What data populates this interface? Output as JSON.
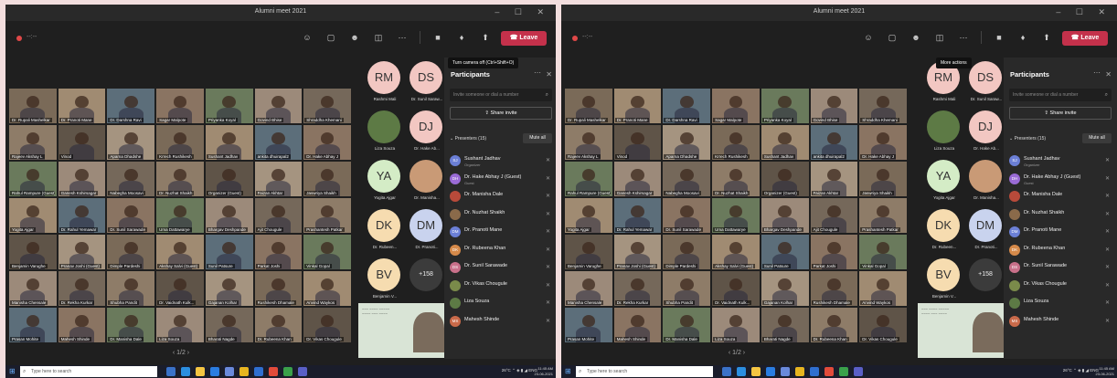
{
  "window": {
    "title": "Alumni meet 2021",
    "controls": "– ☐ ✕"
  },
  "toolbar": {
    "timer": "--:--",
    "icons": [
      "people-icon",
      "chat-icon",
      "reactions-icon",
      "rooms-icon",
      "more-icon",
      "camera-icon",
      "mic-icon",
      "share-icon"
    ],
    "leave_label": "Leave"
  },
  "tooltips": {
    "camera": "Turn camera off (Ctrl+Shift+O)",
    "more": "More actions"
  },
  "gallery": {
    "tiles": [
      "Dr. Rupali Mashelkar",
      "Dr. Pranoti Mane",
      "Dr. Darshna Ravi",
      "Sagar Malpote",
      "Priyanka Koyal",
      "Govind Bhise",
      "Shraddha Khemani",
      "Rajeev Akshay L",
      "Vinod",
      "Aparna Dhadshe",
      "Krrech Rushikesh",
      "Sushant Jadhav",
      "ankita dhuirapal2",
      "Dr. Hake Abhay J",
      "Rahul Rampure (Guest)",
      "Ganesh Kshirsagar",
      "Nabegha Moosavi",
      "Dr. Nuzhat Shaikh",
      "Organizer (Guest)",
      "Faizan Akhtar",
      "Jaswriya Shaikh",
      "Yogita Ajgar",
      "Dr. Rahul Yemawar",
      "Dr. Sunil Sarawade",
      "Uma Dattawarye",
      "Bhargav Deshpande",
      "Ajit Chougule",
      "Prashantesh Patkar",
      "Benjamin Varughe",
      "Pranav Joshi (Guest)",
      "Dimple Pardeshi",
      "Akshay Salvi (Guest)",
      "Sunil Patsure",
      "Parkat Joshi",
      "Vinkal Gopal",
      "Manisha Chensale",
      "Dr. Rekha Kurkar",
      "Shubha Pandit",
      "Dr. Vaidnath Kulk...",
      "Gajanan Kolhar",
      "Rushikesh Dhamale",
      "Anvind Waykos",
      "Prasan Mohite",
      "Mahesh Shinde",
      "Dr. Manisha Dale",
      "Liza Souza",
      "Bharati Nagde",
      "Dr. Rubeena Khan",
      "Dr. Vikas Chougule"
    ],
    "pager": "‹ 1/2 ›"
  },
  "avatars": [
    {
      "initials": "RM",
      "name": "Rashmi Mali",
      "color": "#f2c7c2"
    },
    {
      "initials": "DS",
      "name": "Dr. Sunil Saraw...",
      "color": "#f2c7c2"
    },
    {
      "initials": "",
      "name": "Liza Souza",
      "color": "#5d7a45"
    },
    {
      "initials": "DJ",
      "name": "Dr. Hake Ab...",
      "color": "#f2c7c2"
    },
    {
      "initials": "YA",
      "name": "Yogita Ajgar",
      "color": "#d4ecc6"
    },
    {
      "initials": "",
      "name": "Dr. Manisha...",
      "color": "#c99a76"
    },
    {
      "initials": "DK",
      "name": "Dr. Rubeen...",
      "color": "#f6dcb0"
    },
    {
      "initials": "DM",
      "name": "Dr. Pranoti...",
      "color": "#c9d3ee"
    },
    {
      "initials": "BV",
      "name": "Benjamin V...",
      "color": "#f6dcb0"
    },
    {
      "initials": "+158",
      "name": "",
      "color": "#3b3b3b"
    }
  ],
  "panel": {
    "title": "Participants",
    "invite_placeholder": "Invite someone or dial a number",
    "share_label": "Share invite",
    "presenters_label": "Presenters (15)",
    "mute_all": "Mute all",
    "people": [
      {
        "name": "Sushant Jadhav",
        "role": "Organizer",
        "color": "#6b7fd6",
        "ini": "SJ"
      },
      {
        "name": "Dr. Hake Abhay J (Guest)",
        "role": "Guest",
        "color": "#9a6bd6",
        "ini": "DH"
      },
      {
        "name": "Dr. Manisha Dale",
        "role": "",
        "color": "#b84a3a",
        "ini": ""
      },
      {
        "name": "Dr. Nuzhat Shaikh",
        "role": "",
        "color": "#8a6a4a",
        "ini": ""
      },
      {
        "name": "Dr. Pranoti Mane",
        "role": "",
        "color": "#6b7fd6",
        "ini": "DM"
      },
      {
        "name": "Dr. Rubeena Khan",
        "role": "",
        "color": "#d68a4a",
        "ini": "DK"
      },
      {
        "name": "Dr. Sunil Sarawade",
        "role": "",
        "color": "#c9708a",
        "ini": "DS"
      },
      {
        "name": "Dr. Vikas Chougule",
        "role": "",
        "color": "#7a8a4a",
        "ini": ""
      },
      {
        "name": "Liza Souza",
        "role": "",
        "color": "#5d7a45",
        "ini": ""
      },
      {
        "name": "Mahesh Shinde",
        "role": "",
        "color": "#c96a4a",
        "ini": "MS"
      }
    ]
  },
  "taskbar": {
    "search_placeholder": "Type here to search",
    "weather": "26°C",
    "lang": "ENG",
    "time": "11:45 AM",
    "date": "23-06-2021"
  }
}
